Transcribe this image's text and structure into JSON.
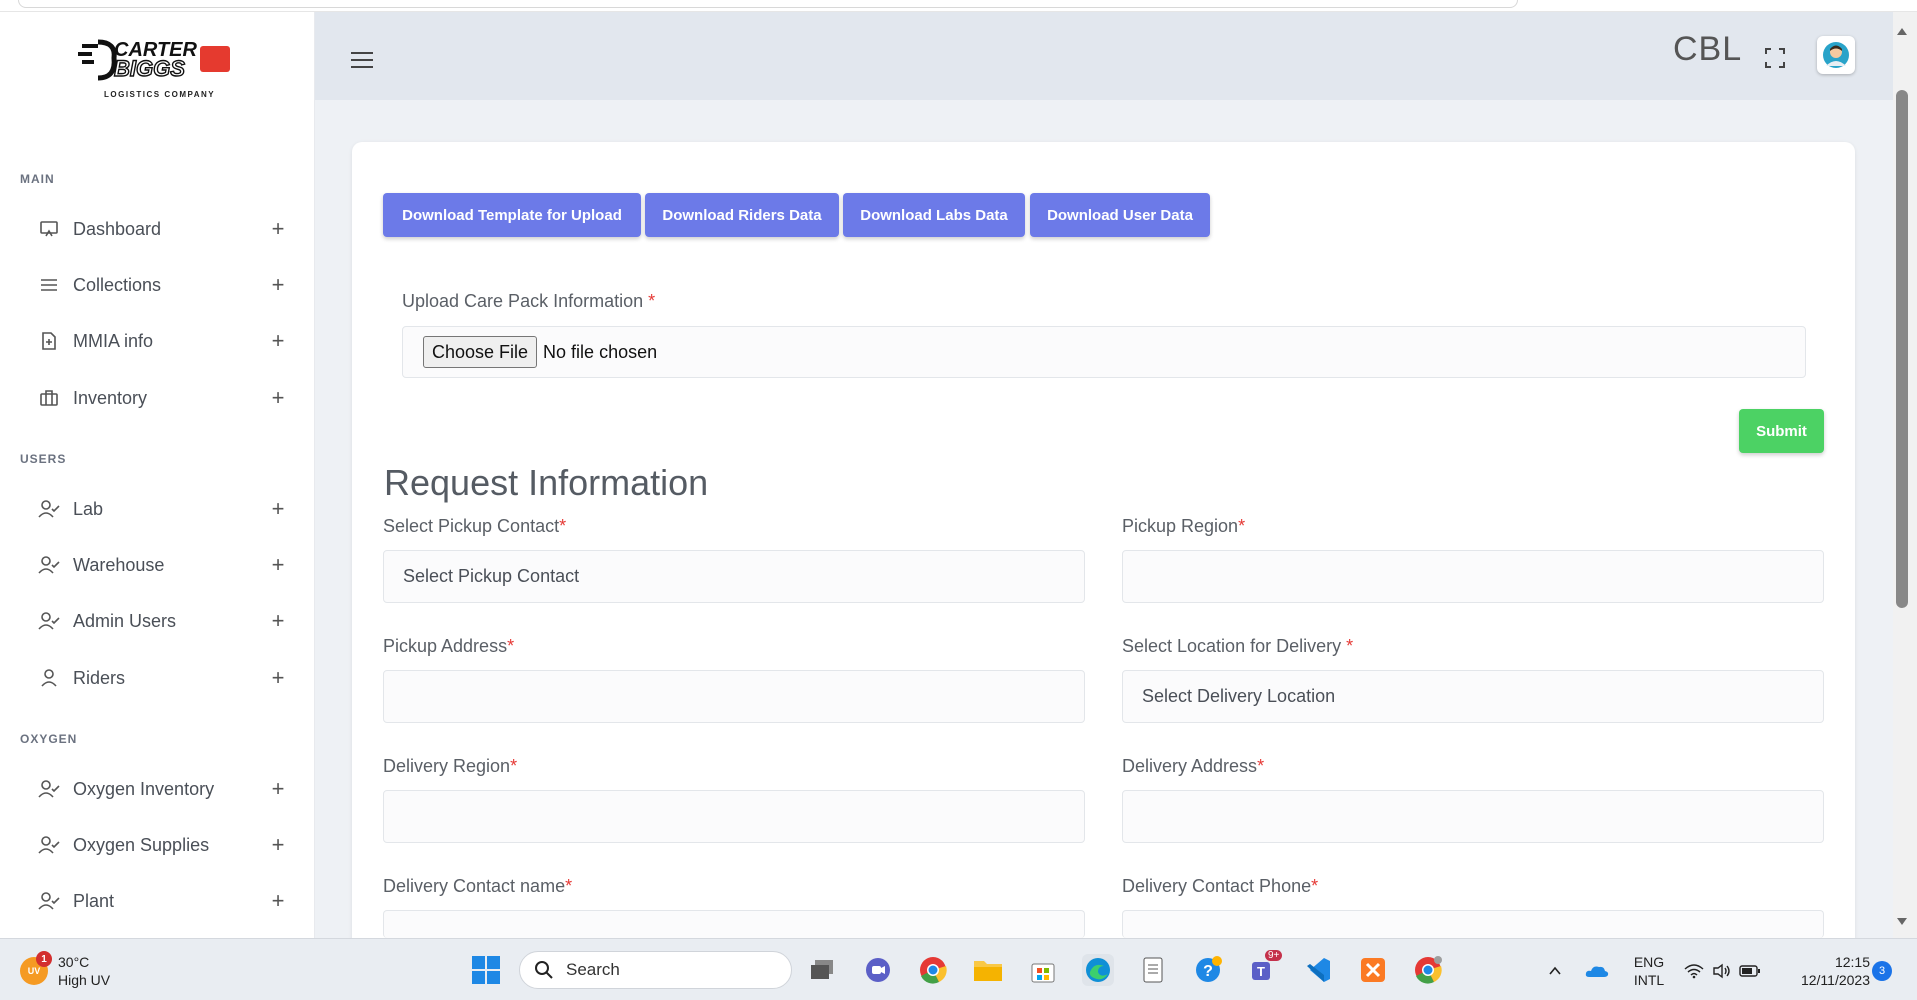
{
  "brand": {
    "logo_text_1": "CARTER",
    "logo_text_2": "BIGGS",
    "logo_sub": "LOGISTICS COMPANY"
  },
  "sidebar": {
    "sections": [
      {
        "title": "MAIN",
        "items": [
          {
            "label": "Dashboard",
            "icon": "monitor-icon"
          },
          {
            "label": "Collections",
            "icon": "list-icon"
          },
          {
            "label": "MMIA info",
            "icon": "file-plus-icon"
          },
          {
            "label": "Inventory",
            "icon": "briefcase-icon"
          }
        ]
      },
      {
        "title": "USERS",
        "items": [
          {
            "label": "Lab",
            "icon": "user-check-icon"
          },
          {
            "label": "Warehouse",
            "icon": "user-check-icon"
          },
          {
            "label": "Admin Users",
            "icon": "user-check-icon"
          },
          {
            "label": "Riders",
            "icon": "user-icon"
          }
        ]
      },
      {
        "title": "OXYGEN",
        "items": [
          {
            "label": "Oxygen Inventory",
            "icon": "user-check-icon"
          },
          {
            "label": "Oxygen Supplies",
            "icon": "user-check-icon"
          },
          {
            "label": "Plant",
            "icon": "user-check-icon"
          }
        ]
      }
    ],
    "expand_symbol": "+"
  },
  "header": {
    "company_code": "CBL",
    "menu_icon": "hamburger-icon",
    "fullscreen_icon": "fullscreen-icon",
    "avatar_icon": "user-avatar-icon"
  },
  "toolbar": {
    "download_template": "Download Template for Upload",
    "download_riders": "Download Riders Data",
    "download_labs": "Download Labs Data",
    "download_users": "Download User Data"
  },
  "upload": {
    "label": "Upload Care Pack Information",
    "required_mark": "*",
    "choose_file": "Choose File",
    "no_file": "No file chosen",
    "submit": "Submit"
  },
  "request": {
    "title": "Request Information",
    "fields": {
      "pickup_contact": {
        "label": "Select Pickup Contact",
        "value": "Select Pickup Contact"
      },
      "pickup_region": {
        "label": "Pickup Region",
        "value": ""
      },
      "pickup_address": {
        "label": "Pickup Address",
        "value": ""
      },
      "delivery_location": {
        "label": "Select Location for Delivery ",
        "value": "Select Delivery Location"
      },
      "delivery_region": {
        "label": "Delivery Region",
        "value": ""
      },
      "delivery_address": {
        "label": "Delivery Address",
        "value": ""
      },
      "delivery_contact_name": {
        "label": "Delivery Contact name",
        "value": ""
      },
      "delivery_contact_phone": {
        "label": "Delivery Contact Phone",
        "value": ""
      }
    },
    "required_mark": "*"
  },
  "taskbar": {
    "weather_temp": "30°C",
    "weather_desc": "High UV",
    "weather_badge": "1",
    "weather_icon_text": "UV",
    "search_placeholder": "Search",
    "lang_1": "ENG",
    "lang_2": "INTL",
    "time": "12:15",
    "date": "12/11/2023",
    "notification_count": "3",
    "teams_badge": "9+"
  },
  "colors": {
    "primary_button": "#6c7ae8",
    "submit_button": "#4cd264",
    "required": "#e53935",
    "header_bg": "#e2e7ee"
  }
}
